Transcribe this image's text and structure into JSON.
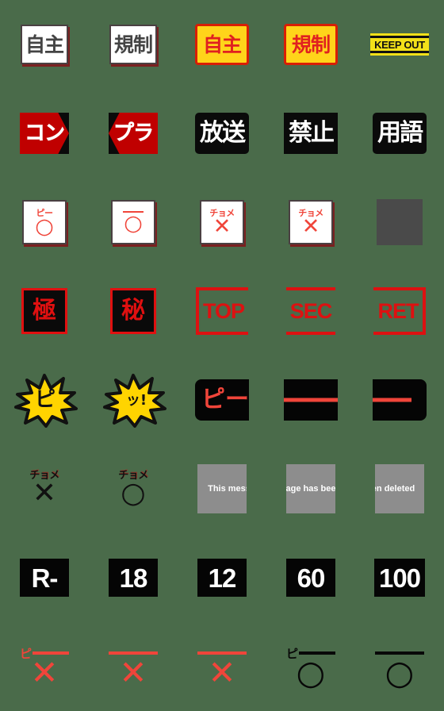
{
  "meta": {
    "background_color": "#4a6b4a",
    "columns": 5,
    "rows": 8,
    "total_cells": 40
  },
  "palette": {
    "red": "#E02020",
    "bright_red": "#F0453A",
    "stamp_red": "#DD1111",
    "dark_red": "#C00000",
    "yellow": "#FFD41A",
    "tape_yellow": "#F2E019",
    "black": "#0a0a0a",
    "white": "#ffffff",
    "gray_box": "#8d8d8d",
    "dark_gray": "#4a4a4a"
  },
  "cells": [
    {
      "id": "jishu-white",
      "name": "jishu-white-box",
      "text": "自主"
    },
    {
      "id": "kisei-white",
      "name": "kisei-white-box",
      "text": "規制"
    },
    {
      "id": "jishu-yellow",
      "name": "jishu-yellow-box",
      "text": "自主"
    },
    {
      "id": "kisei-yellow",
      "name": "kisei-yellow-box",
      "text": "規制"
    },
    {
      "id": "keep-out",
      "name": "keep-out-tape",
      "text": "KEEP OUT"
    },
    {
      "id": "kon",
      "name": "kon-chevron-badge",
      "text": "コン"
    },
    {
      "id": "pura",
      "name": "pura-chevron-badge",
      "text": "プラ"
    },
    {
      "id": "housou",
      "name": "housou-black-box",
      "text": "放送"
    },
    {
      "id": "kinshi",
      "name": "kinshi-black-box",
      "text": "禁止"
    },
    {
      "id": "yougo",
      "name": "yougo-black-box",
      "text": "用語"
    },
    {
      "id": "pi-maru",
      "name": "pi-circle-censor-box",
      "top": "ピー",
      "mark": "○"
    },
    {
      "id": "bar-maru",
      "name": "bar-circle-censor-box",
      "top": "",
      "mark": "○"
    },
    {
      "id": "chome-batsu-1",
      "name": "chome-cross-censor-box",
      "top": "チョメ",
      "mark": "✕"
    },
    {
      "id": "chome-batsu-2",
      "name": "chome-cross-censor-box",
      "top": "チョメ",
      "mark": "✕"
    },
    {
      "id": "gray-square",
      "name": "solid-gray-square",
      "text": ""
    },
    {
      "id": "goku",
      "name": "goku-secret-badge",
      "text": "極"
    },
    {
      "id": "hi",
      "name": "hi-secret-badge",
      "text": "秘"
    },
    {
      "id": "stamp-top",
      "name": "stamp-top",
      "text": "TOP"
    },
    {
      "id": "stamp-sec",
      "name": "stamp-sec",
      "text": "SEC"
    },
    {
      "id": "stamp-ret",
      "name": "stamp-ret",
      "text": "RET"
    },
    {
      "id": "burst-pi",
      "name": "yellow-burst-pi",
      "text": "ピ"
    },
    {
      "id": "burst-tsu",
      "name": "yellow-burst-tsu",
      "text": "ッ!"
    },
    {
      "id": "beep-pi-box",
      "name": "beep-bar-pi-box",
      "text": "ピー"
    },
    {
      "id": "beep-bar-mid",
      "name": "beep-bar-middle",
      "text": ""
    },
    {
      "id": "beep-bar-end",
      "name": "beep-bar-end",
      "text": ""
    },
    {
      "id": "chome-cross",
      "name": "chome-cross-plain",
      "top": "チョメ",
      "mark": "✕"
    },
    {
      "id": "chome-circle",
      "name": "chome-circle-plain",
      "top": "チョメ",
      "mark": "○"
    },
    {
      "id": "deleted-1",
      "name": "deleted-message-part-1",
      "text": "This mess"
    },
    {
      "id": "deleted-2",
      "name": "deleted-message-part-2",
      "text": "age has bee"
    },
    {
      "id": "deleted-3",
      "name": "deleted-message-part-3",
      "text": "en deleted"
    },
    {
      "id": "rating-r",
      "name": "rating-badge-r",
      "text": "R-"
    },
    {
      "id": "rating-18",
      "name": "rating-badge-18",
      "text": "18"
    },
    {
      "id": "rating-12",
      "name": "rating-badge-12",
      "text": "12"
    },
    {
      "id": "rating-60",
      "name": "rating-badge-60",
      "text": "60"
    },
    {
      "id": "rating-100",
      "name": "rating-badge-100",
      "text": "100"
    },
    {
      "id": "bare-pi-cross",
      "name": "bare-pi-cross-red",
      "top": "ピ",
      "mark": "✕"
    },
    {
      "id": "bare-bar-cross-1",
      "name": "bare-bar-cross-red",
      "top": "",
      "mark": "✕"
    },
    {
      "id": "bare-bar-cross-2",
      "name": "bare-bar-cross-red",
      "top": "",
      "mark": "✕"
    },
    {
      "id": "bare-pi-circle",
      "name": "bare-pi-circle-black",
      "top": "ピ",
      "mark": "○"
    },
    {
      "id": "bare-bar-circle",
      "name": "bare-bar-circle-black",
      "top": "",
      "mark": "○"
    }
  ]
}
